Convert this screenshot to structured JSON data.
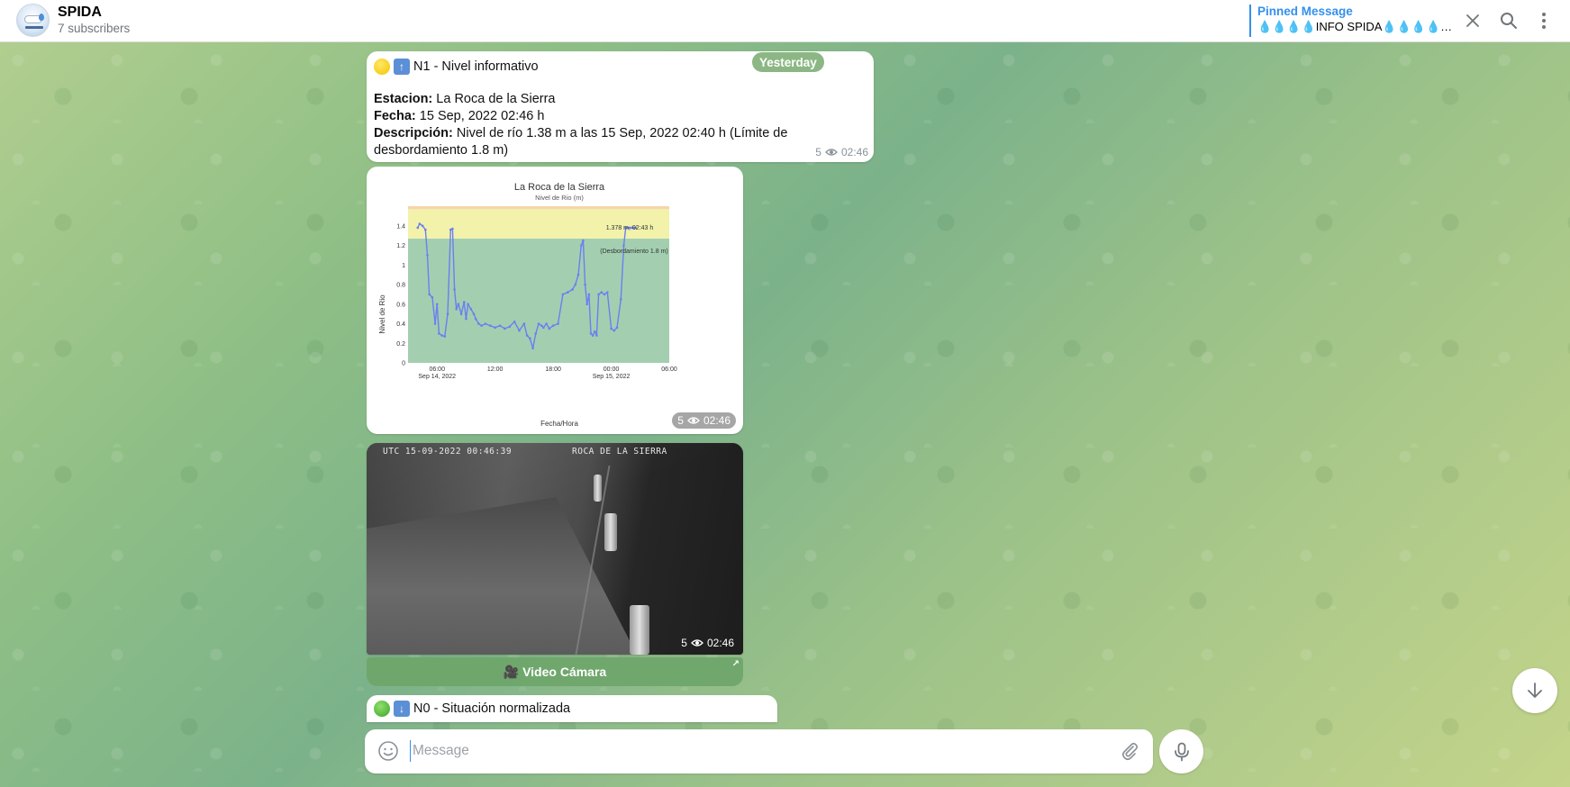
{
  "header": {
    "channel_name": "SPIDA",
    "subscribers": "7 subscribers",
    "pinned_title": "Pinned Message",
    "pinned_text": "💧💧💧💧INFO SPIDA💧💧💧💧⚫..."
  },
  "date_badge": "Yesterday",
  "message1": {
    "title": "N1 - Nivel informativo",
    "estacion_label": "Estacion:",
    "estacion_value": "La Roca de la Sierra",
    "fecha_label": "Fecha:",
    "fecha_value": "15 Sep, 2022 02:46 h",
    "descripcion_label": "Descripción:",
    "descripcion_value": "Nivel de río 1.38 m a las 15 Sep, 2022 02:40 h (Límite de desbordamiento 1.8 m)",
    "views": "5",
    "time": "02:46"
  },
  "message2": {
    "views": "5",
    "time": "02:46"
  },
  "message3": {
    "cam_timestamp": "UTC 15-09-2022 00:46:39",
    "cam_location": "ROCA DE LA SIERRA",
    "views": "5",
    "time": "02:46",
    "button_label": "🎥 Video Cámara"
  },
  "message4": {
    "title": "N0 - Situación normalizada"
  },
  "composer": {
    "placeholder": "Message"
  },
  "chart_data": {
    "type": "line",
    "title": "La Roca de la Sierra",
    "subtitle": "Nivel de Rio (m)",
    "xlabel": "Fecha/Hora",
    "ylabel": "Nivel de Rio",
    "ylim": [
      0,
      1.6
    ],
    "yticks": [
      "0",
      "0.2",
      "0.4",
      "0.6",
      "0.8",
      "1",
      "1.2",
      "1.4"
    ],
    "xticks": [
      "06:00\nSep 14, 2022",
      "12:00",
      "18:00",
      "00:00\nSep 15, 2022",
      "06:00"
    ],
    "x_hours": [
      0,
      3,
      9,
      15,
      21,
      27
    ],
    "bands": [
      {
        "from": 0,
        "to": 1.27,
        "color": "#a3cfb0"
      },
      {
        "from": 1.27,
        "to": 1.57,
        "color": "#f2f2aa"
      },
      {
        "from": 1.57,
        "to": 1.6,
        "color": "#f5d5a8"
      }
    ],
    "annotations": [
      "1.378 m, 02:43 h",
      "(Desbordamiento 1.8 m)"
    ],
    "series": [
      {
        "color": "#6b7ff0",
        "x": [
          1.0,
          1.2,
          1.5,
          1.8,
          2.0,
          2.2,
          2.5,
          2.8,
          3.0,
          3.2,
          3.5,
          3.8,
          4.1,
          4.4,
          4.6,
          4.8,
          5.0,
          5.2,
          5.5,
          5.8,
          6.0,
          6.2,
          6.5,
          6.8,
          7.0,
          7.3,
          7.6,
          8.0,
          8.5,
          9.0,
          9.5,
          10.0,
          10.5,
          11.0,
          11.5,
          12.0,
          12.3,
          12.6,
          12.9,
          13.2,
          13.5,
          13.8,
          14.0,
          14.3,
          14.6,
          15.0,
          15.5,
          16.0,
          16.5,
          17.0,
          17.3,
          17.6,
          17.9,
          18.1,
          18.3,
          18.5,
          18.7,
          18.9,
          19.1,
          19.3,
          19.5,
          19.7,
          20.0,
          20.3,
          20.6,
          21.0,
          21.3,
          21.6,
          22.0,
          22.3,
          22.5,
          22.7,
          22.9,
          23.1,
          23.3,
          23.5
        ],
        "y": [
          1.38,
          1.42,
          1.4,
          1.36,
          1.1,
          0.7,
          0.67,
          0.4,
          0.6,
          0.3,
          0.28,
          0.27,
          0.5,
          1.36,
          1.37,
          0.75,
          0.55,
          0.6,
          0.5,
          0.62,
          0.45,
          0.6,
          0.55,
          0.5,
          0.45,
          0.4,
          0.38,
          0.4,
          0.38,
          0.36,
          0.38,
          0.35,
          0.37,
          0.42,
          0.33,
          0.4,
          0.28,
          0.25,
          0.15,
          0.3,
          0.4,
          0.38,
          0.36,
          0.4,
          0.35,
          0.38,
          0.4,
          0.7,
          0.72,
          0.75,
          0.8,
          0.9,
          1.2,
          1.25,
          0.8,
          0.6,
          0.7,
          0.3,
          0.28,
          0.32,
          0.28,
          0.7,
          0.72,
          0.7,
          0.72,
          0.35,
          0.33,
          0.36,
          0.65,
          1.2,
          1.38,
          1.38,
          1.38,
          1.38,
          1.38,
          1.38
        ]
      }
    ]
  }
}
